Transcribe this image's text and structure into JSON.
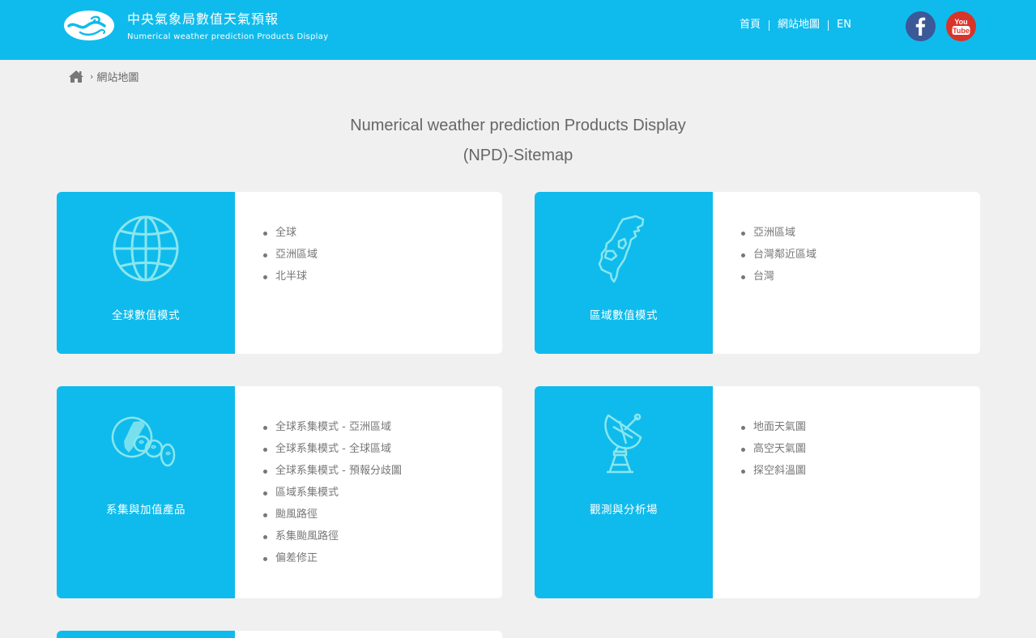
{
  "header": {
    "title": "中央氣象局數值天氣預報",
    "subtitle": "Numerical weather prediction Products Display",
    "nav": [
      {
        "label": "首頁"
      },
      {
        "label": "網站地圖"
      },
      {
        "label": "EN"
      }
    ],
    "social": [
      {
        "name": "facebook",
        "icon": "facebook-icon",
        "color": "#3b5898"
      },
      {
        "name": "youtube",
        "icon": "youtube-icon",
        "color": "#d8342a"
      }
    ],
    "background_color": "#0fbbec"
  },
  "breadcrumb": {
    "home_icon": "home-icon",
    "separator": "›",
    "current": "網站地圖"
  },
  "page_title": {
    "line1": "Numerical weather prediction Products Display",
    "line2": "(NPD)-Sitemap"
  },
  "cards": [
    {
      "label": "全球數值模式",
      "icon": "globe-icon",
      "items": [
        "全球",
        "亞洲區域",
        "北半球"
      ]
    },
    {
      "label": "區域數值模式",
      "icon": "taiwan-map-icon",
      "items": [
        "亞洲區域",
        "台灣鄰近區域",
        "台灣"
      ]
    },
    {
      "label": "系集與加值產品",
      "icon": "ensemble-icon",
      "items": [
        "全球系集模式 - 亞洲區域",
        "全球系集模式 - 全球區域",
        "全球系集模式 - 預報分歧圖",
        "區域系集模式",
        "颱風路徑",
        "系集颱風路徑",
        "偏差修正"
      ]
    },
    {
      "label": "觀測與分析場",
      "icon": "satellite-dish-icon",
      "items": [
        "地面天氣圖",
        "高空天氣圖",
        "探空斜溫圖"
      ]
    }
  ],
  "colors": {
    "accent": "#0fbbec",
    "page_background": "#f0f0f0",
    "icon_stroke": "#8ae6ee"
  }
}
